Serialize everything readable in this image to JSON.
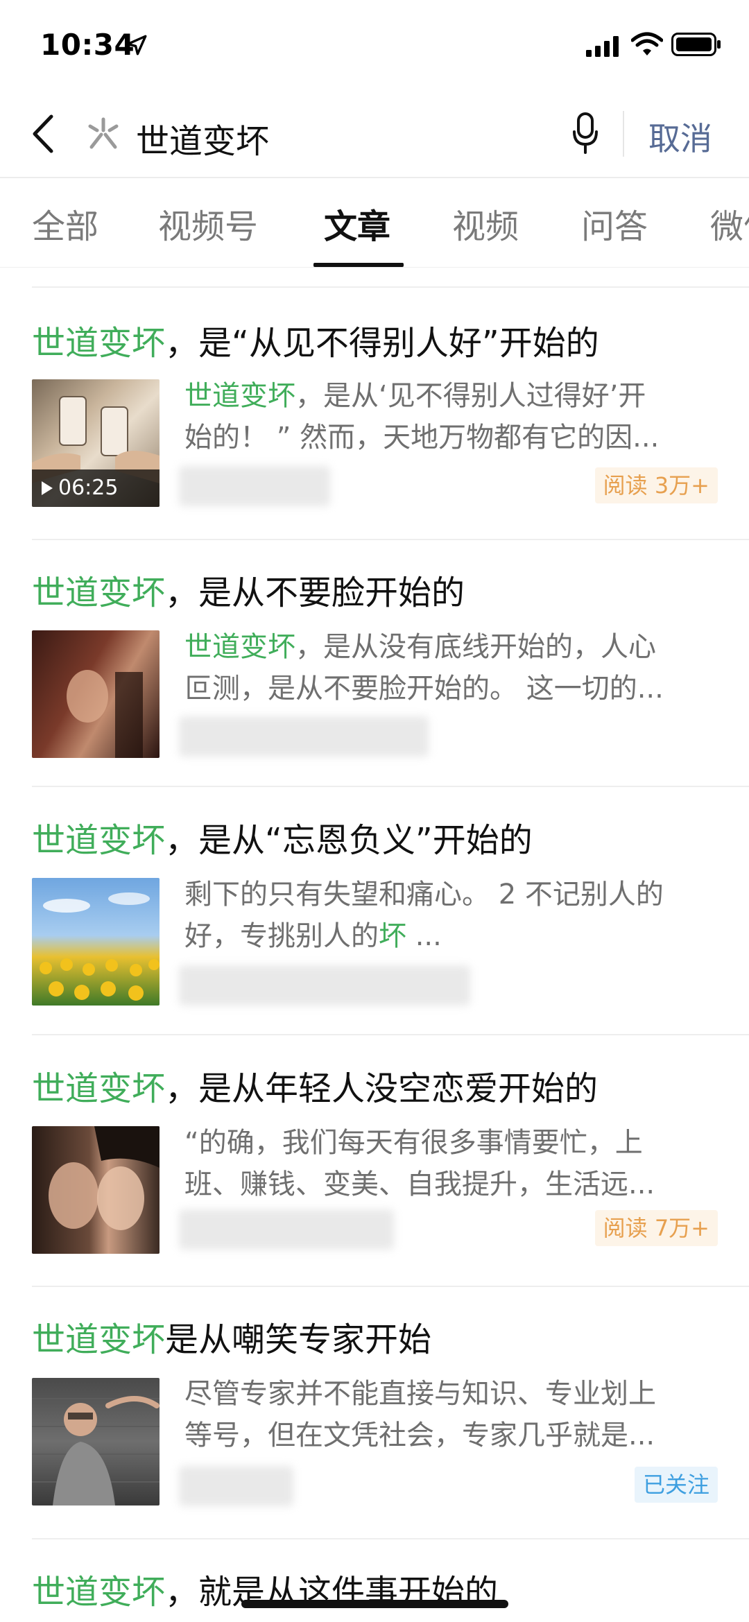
{
  "status_bar": {
    "time": "10:34"
  },
  "search": {
    "query": "世道变坏",
    "cancel_label": "取消"
  },
  "tabs": [
    {
      "label": "全部",
      "active": false
    },
    {
      "label": "视频号",
      "active": false
    },
    {
      "label": "文章",
      "active": true
    },
    {
      "label": "视频",
      "active": false
    },
    {
      "label": "问答",
      "active": false
    },
    {
      "label": "微信",
      "active": false
    }
  ],
  "colors": {
    "highlight": "#40ad5a",
    "link": "#576b95",
    "read_badge": "#e7a04f",
    "follow_badge": "#3e9fe0"
  },
  "results": [
    {
      "title_highlight": "世道变坏",
      "title_rest": "，是“从见不得别人好”开始的",
      "snippet_line1_highlight": "世道变坏",
      "snippet_line1_rest": "，是从‘见不得别人过得好’开",
      "snippet_line2": "始的！ ” 然而，天地万物都有它的因...",
      "duration": "06:25",
      "badge": "阅读 3万+"
    },
    {
      "title_highlight": "世道变坏",
      "title_rest": "，是从不要脸开始的",
      "snippet_line1_highlight": "世道变坏",
      "snippet_line1_rest": "，是从没有底线开始的，人心",
      "snippet_line2": "叵测，是从不要脸开始的。 这一切的..."
    },
    {
      "title_highlight": "世道变坏",
      "title_rest": "，是从“忘恩负义”开始的",
      "snippet_line1": "剩下的只有失望和痛心。 2 不记别人的",
      "snippet_line2_prefix": "好，专挑别人的",
      "snippet_line2_highlight": "坏",
      "snippet_line2_suffix": " ..."
    },
    {
      "title_highlight": "世道变坏",
      "title_rest": "，是从年轻人没空恋爱开始的",
      "snippet_line1": "“的确，我们每天有很多事情要忙，上",
      "snippet_line2": "班、赚钱、变美、自我提升，生活远...",
      "badge": "阅读 7万+"
    },
    {
      "title_highlight": "世道变坏",
      "title_rest": "是从嘲笑专家开始",
      "snippet_line1": "尽管专家并不能直接与知识、专业划上",
      "snippet_line2": "等号，但在文凭社会，专家几乎就是...",
      "badge": "已关注"
    },
    {
      "title_highlight": "世道变坏",
      "title_rest": "，就是从这件事开始的"
    }
  ]
}
